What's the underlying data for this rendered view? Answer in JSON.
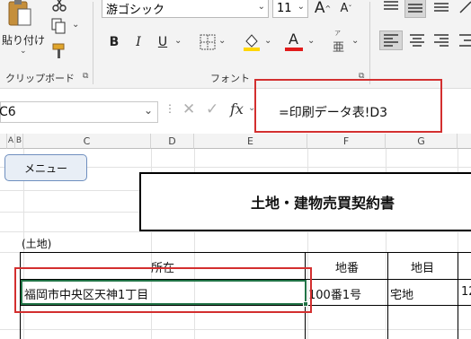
{
  "ribbon": {
    "clipboard": {
      "paste_label": "貼り付け",
      "group_label": "クリップボード"
    },
    "font": {
      "font_name": "游ゴシック",
      "font_size": "11",
      "grow_label": "A",
      "shrink_label": "A",
      "bold": "B",
      "italic": "I",
      "underline": "U",
      "font_color_label": "A",
      "group_label": "フォント",
      "phonetic_label": "亜"
    },
    "colors": {
      "fill": "#ffd600",
      "font": "#e11b1b",
      "accent": "#217346"
    }
  },
  "formula_bar": {
    "name_box": "C6",
    "fx": "fx",
    "formula": "=印刷データ表!D3"
  },
  "columns": [
    "A",
    "B",
    "C",
    "D",
    "E",
    "F",
    "G"
  ],
  "sheet": {
    "menu_button": "メニュー",
    "title": "土地・建物売買契約書",
    "section_label": "(土地)",
    "headers": {
      "address": "所在",
      "lot": "地番",
      "category": "地目"
    },
    "row": {
      "address": "福岡市中央区天神1丁目",
      "lot": "100番1号",
      "category": "宅地",
      "extra": "12"
    }
  },
  "highlight_color": "#d32f2f"
}
